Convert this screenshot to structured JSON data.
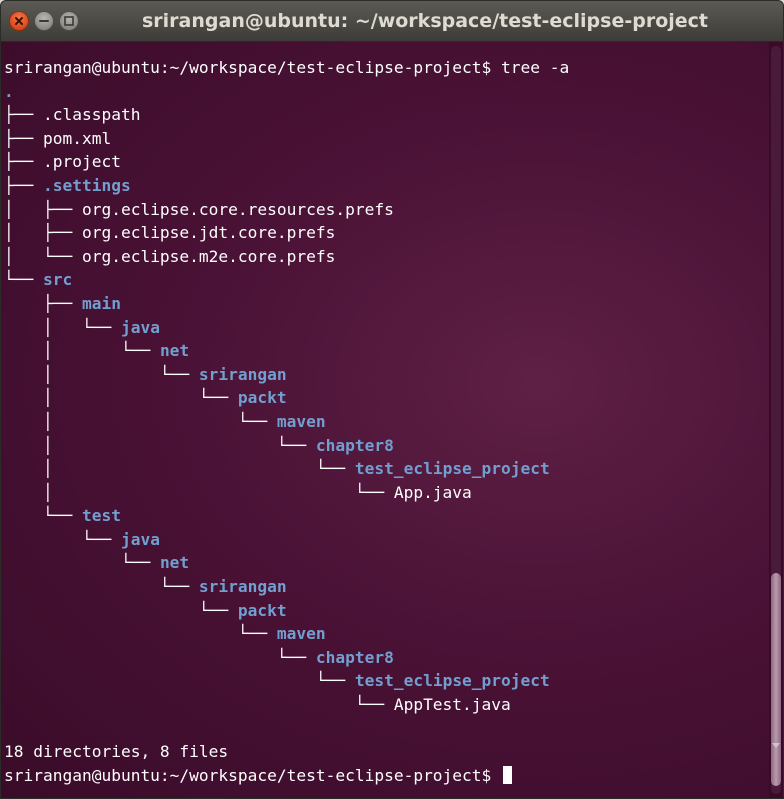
{
  "window": {
    "title": "srirangan@ubuntu: ~/workspace/test-eclipse-project"
  },
  "terminal": {
    "lines": [
      {
        "indent": "",
        "text": "srirangan@ubuntu:~/workspace/test-eclipse-project$ tree -a",
        "dir": false
      },
      {
        "indent": "",
        "text": ".",
        "dir": true
      },
      {
        "indent": "├── ",
        "text": ".classpath",
        "dir": false
      },
      {
        "indent": "├── ",
        "text": "pom.xml",
        "dir": false
      },
      {
        "indent": "├── ",
        "text": ".project",
        "dir": false
      },
      {
        "indent": "├── ",
        "text": ".settings",
        "dir": true
      },
      {
        "indent": "│   ├── ",
        "text": "org.eclipse.core.resources.prefs",
        "dir": false
      },
      {
        "indent": "│   ├── ",
        "text": "org.eclipse.jdt.core.prefs",
        "dir": false
      },
      {
        "indent": "│   └── ",
        "text": "org.eclipse.m2e.core.prefs",
        "dir": false
      },
      {
        "indent": "└── ",
        "text": "src",
        "dir": true
      },
      {
        "indent": "    ├── ",
        "text": "main",
        "dir": true
      },
      {
        "indent": "    │   └── ",
        "text": "java",
        "dir": true
      },
      {
        "indent": "    │       └── ",
        "text": "net",
        "dir": true
      },
      {
        "indent": "    │           └── ",
        "text": "srirangan",
        "dir": true
      },
      {
        "indent": "    │               └── ",
        "text": "packt",
        "dir": true
      },
      {
        "indent": "    │                   └── ",
        "text": "maven",
        "dir": true
      },
      {
        "indent": "    │                       └── ",
        "text": "chapter8",
        "dir": true
      },
      {
        "indent": "    │                           └── ",
        "text": "test_eclipse_project",
        "dir": true
      },
      {
        "indent": "    │                               └── ",
        "text": "App.java",
        "dir": false
      },
      {
        "indent": "    └── ",
        "text": "test",
        "dir": true
      },
      {
        "indent": "        └── ",
        "text": "java",
        "dir": true
      },
      {
        "indent": "            └── ",
        "text": "net",
        "dir": true
      },
      {
        "indent": "                └── ",
        "text": "srirangan",
        "dir": true
      },
      {
        "indent": "                    └── ",
        "text": "packt",
        "dir": true
      },
      {
        "indent": "                        └── ",
        "text": "maven",
        "dir": true
      },
      {
        "indent": "                            └── ",
        "text": "chapter8",
        "dir": true
      },
      {
        "indent": "                                └── ",
        "text": "test_eclipse_project",
        "dir": true
      },
      {
        "indent": "                                    └── ",
        "text": "AppTest.java",
        "dir": false
      },
      {
        "indent": "",
        "text": "",
        "dir": false
      },
      {
        "indent": "",
        "text": "18 directories, 8 files",
        "dir": false
      },
      {
        "indent": "",
        "text": "srirangan@ubuntu:~/workspace/test-eclipse-project$ ",
        "dir": false,
        "cursor": true
      }
    ]
  },
  "colors": {
    "terminal_background": "#4a1236",
    "text": "#ffffff",
    "directory": "#729fcf",
    "close_button": "#e2501f"
  },
  "icons": {
    "close": "close-icon",
    "minimize": "minimize-icon",
    "maximize": "maximize-icon"
  }
}
